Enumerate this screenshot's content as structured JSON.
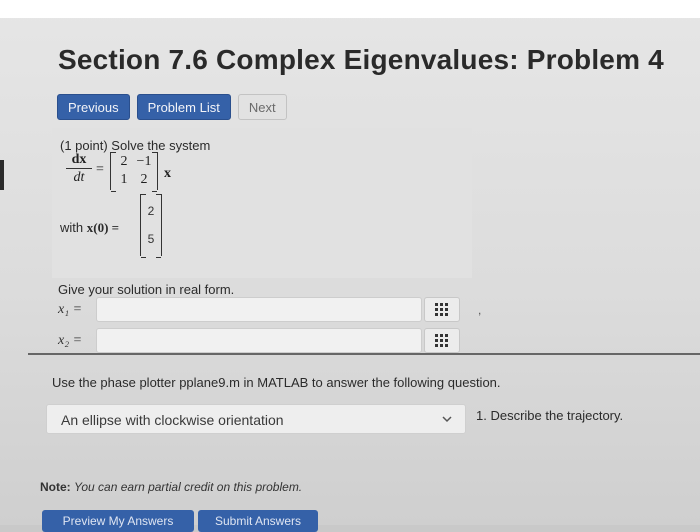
{
  "header": {
    "title": "Section 7.6 Complex Eigenvalues: Problem 4"
  },
  "nav": {
    "previous": "Previous",
    "problem_list": "Problem List",
    "next": "Next"
  },
  "problem": {
    "points": "(1 point) Solve the system",
    "derivative_num": "dx",
    "derivative_den": "dt",
    "equals": "=",
    "matrix": [
      [
        "2",
        "−1"
      ],
      [
        "1",
        "2"
      ]
    ],
    "vector_symbol": "x",
    "with_label": "with",
    "initial_label": "x(0) =",
    "initial_vector": [
      "2",
      "5"
    ]
  },
  "answers": {
    "instruction": "Give your solution in real form.",
    "fields": [
      {
        "label": "x₁ =",
        "value": "",
        "suffix": ","
      },
      {
        "label": "x₂ =",
        "value": "",
        "suffix": ""
      }
    ],
    "grid_icon": "matrix-grid-icon"
  },
  "matlab": {
    "instruction": "Use the phase plotter pplane9.m in MATLAB to answer the following question.",
    "selected": "An ellipse with clockwise orientation",
    "question": "1. Describe the trajectory."
  },
  "note": {
    "label": "Note:",
    "text": "You can earn partial credit on this problem."
  },
  "footer": {
    "preview": "Preview My Answers",
    "submit": "Submit Answers"
  },
  "colors": {
    "primary": "#3561a8",
    "background": "#dcdcdc"
  }
}
